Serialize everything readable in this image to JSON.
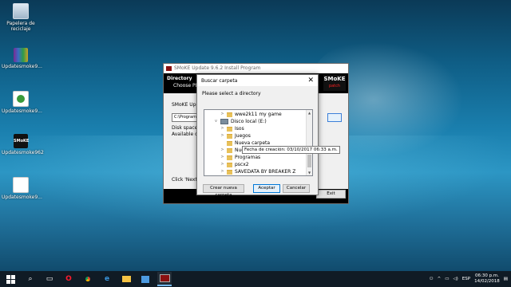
{
  "desktop_icons": [
    {
      "label": "Papelera de reciclaje",
      "icon": "recycle-bin-icon"
    },
    {
      "label": "Updatesmoke9...",
      "icon": "winrar-archive-icon"
    },
    {
      "label": "Updatesmoke9...",
      "icon": "document-icon"
    },
    {
      "label": "Updatesmoke962",
      "icon": "smoke-app-icon"
    },
    {
      "label": "Updatesmoke9...",
      "icon": "blank-file-icon"
    }
  ],
  "installer": {
    "title": "SMoKE Update 9.6.2 Install Program",
    "header_title": "Directory",
    "header_subtitle": "Choose PES",
    "logo_text": "SMoKE",
    "logo_sub": "patch",
    "line1": "SMoKE Upda",
    "path_value": "C:\\Program F",
    "disk_space": "Disk space re",
    "available": "Available disk",
    "click_next": "Click 'Next' to",
    "exit_label": "Exit"
  },
  "dialog": {
    "title": "Buscar carpeta",
    "close_glyph": "✕",
    "prompt": "Please select a directory",
    "tree": [
      {
        "label": "wwe2k11 my game",
        "arrow": ">",
        "kind": "folder"
      },
      {
        "label": "Disco local (E:)",
        "arrow": "v",
        "kind": "drive"
      },
      {
        "label": "Isos",
        "arrow": ">",
        "kind": "folder"
      },
      {
        "label": "Juegos",
        "arrow": ">",
        "kind": "folder"
      },
      {
        "label": "Nueva carpeta",
        "arrow": "",
        "kind": "folder"
      },
      {
        "label": "Nue",
        "arrow": ">",
        "kind": "folder"
      },
      {
        "label": "Programas",
        "arrow": ">",
        "kind": "folder"
      },
      {
        "label": "pscx2",
        "arrow": ">",
        "kind": "folder"
      },
      {
        "label": "SAVEDATA BY BREAKER Z",
        "arrow": ">",
        "kind": "folder"
      }
    ],
    "tooltip": "Fecha de creación: 03/10/2017 06:33 a.m.",
    "buttons": {
      "new_folder": "Crear nueva carpeta",
      "ok": "Aceptar",
      "cancel": "Cancelar"
    }
  },
  "taskbar": {
    "items": [
      "windows-start-icon",
      "search-icon",
      "task-view-icon",
      "opera-icon",
      "chrome-icon",
      "edge-icon",
      "file-explorer-icon",
      "store-icon",
      "smoke-installer-icon"
    ],
    "language": "ESP",
    "time": "06:30 p.m.",
    "date": "14/02/2018"
  }
}
